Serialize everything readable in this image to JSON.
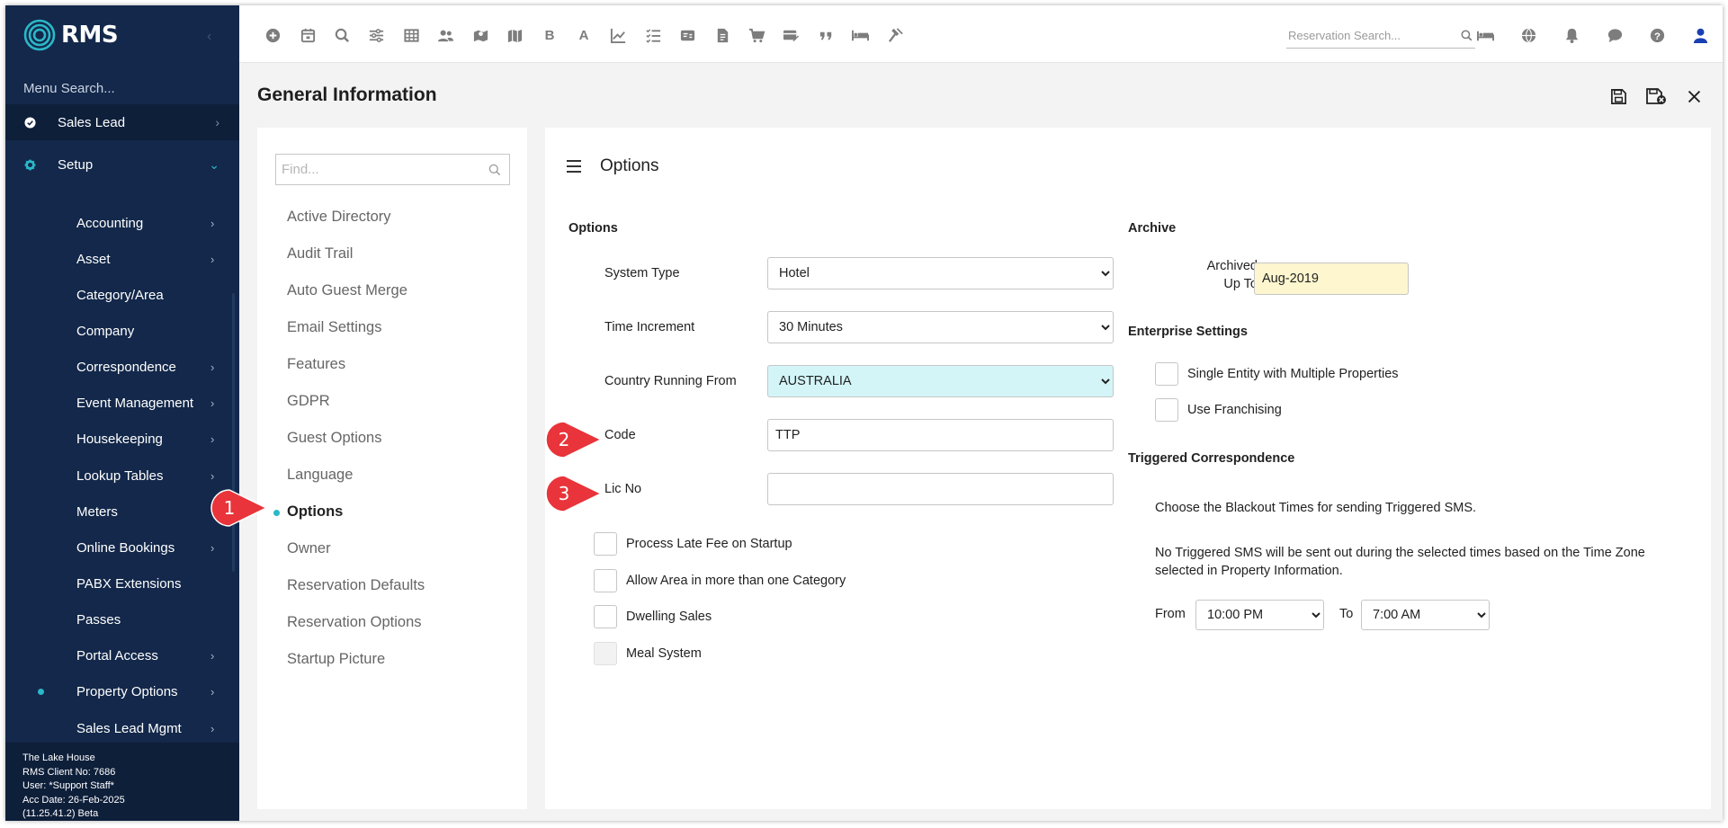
{
  "app": {
    "logo_text": "RMS"
  },
  "sidebar": {
    "menu_search": "Menu Search...",
    "top_item": {
      "label": "Sales Lead",
      "icon": "check-circle-icon"
    },
    "setup": {
      "label": "Setup",
      "icon": "gear-icon"
    },
    "items": [
      {
        "label": "Accounting",
        "chevron": true
      },
      {
        "label": "Asset",
        "chevron": true
      },
      {
        "label": "Category/Area",
        "chevron": false
      },
      {
        "label": "Company",
        "chevron": false
      },
      {
        "label": "Correspondence",
        "chevron": true
      },
      {
        "label": "Event Management",
        "chevron": true
      },
      {
        "label": "Housekeeping",
        "chevron": true
      },
      {
        "label": "Lookup Tables",
        "chevron": true
      },
      {
        "label": "Meters",
        "chevron": false
      },
      {
        "label": "Online Bookings",
        "chevron": true
      },
      {
        "label": "PABX Extensions",
        "chevron": false
      },
      {
        "label": "Passes",
        "chevron": false
      },
      {
        "label": "Portal Access",
        "chevron": true
      },
      {
        "label": "Property Options",
        "chevron": true,
        "active": true
      },
      {
        "label": "Sales Lead Mgmt",
        "chevron": true
      }
    ],
    "footer": {
      "property": "The Lake House",
      "client_no": "RMS Client No: 7686",
      "user": "User: *Support Staff*",
      "acc_date": "Acc Date: 26-Feb-2025",
      "version": "(11.25.41.2)  Beta"
    }
  },
  "topbar": {
    "letter_icons": {
      "bold": "B",
      "font": "A"
    },
    "search_placeholder": "Reservation Search..."
  },
  "header": {
    "title": "General Information"
  },
  "left_panel": {
    "find_placeholder": "Find...",
    "items": [
      "Active Directory",
      "Audit Trail",
      "Auto Guest Merge",
      "Email Settings",
      "Features",
      "GDPR",
      "Guest Options",
      "Language",
      "Options",
      "Owner",
      "Reservation Defaults",
      "Reservation Options",
      "Startup Picture"
    ],
    "active_item": "Options"
  },
  "main": {
    "title": "Options",
    "options_section": {
      "heading": "Options",
      "system_type": {
        "label": "System Type",
        "value": "Hotel"
      },
      "time_increment": {
        "label": "Time Increment",
        "value": "30 Minutes"
      },
      "country": {
        "label": "Country Running From",
        "value": "AUSTRALIA"
      },
      "code": {
        "label": "Code",
        "value": "TTP"
      },
      "lic_no": {
        "label": "Lic No",
        "value": ""
      },
      "checkboxes": [
        {
          "label": "Process Late Fee on Startup",
          "checked": false
        },
        {
          "label": "Allow Area in more than one Category",
          "checked": false
        },
        {
          "label": "Dwelling Sales",
          "checked": false
        },
        {
          "label": "Meal System",
          "checked": false,
          "disabled": true
        }
      ]
    },
    "archive": {
      "heading": "Archive",
      "label_line1": "Archived",
      "label_line2": "Up To",
      "value": "Aug-2019"
    },
    "enterprise": {
      "heading": "Enterprise Settings",
      "checkboxes": [
        {
          "label": "Single Entity with Multiple Properties",
          "checked": false
        },
        {
          "label": "Use Franchising",
          "checked": false
        }
      ]
    },
    "triggered": {
      "heading": "Triggered Correspondence",
      "text1": "Choose the Blackout Times for sending Triggered SMS.",
      "text2": "No Triggered SMS will be sent out during the selected times based on the Time Zone selected in Property Information.",
      "from_label": "From",
      "from_value": "10:00 PM",
      "to_label": "To",
      "to_value": "7:00 AM"
    }
  },
  "callouts": [
    "1",
    "2",
    "3"
  ],
  "colors": {
    "sidebar_bg": "#13284a",
    "accent": "#2bb8c8",
    "callout": "#e8343a",
    "archive_bg": "#fdf6cf",
    "country_bg": "#d3f5f8"
  }
}
